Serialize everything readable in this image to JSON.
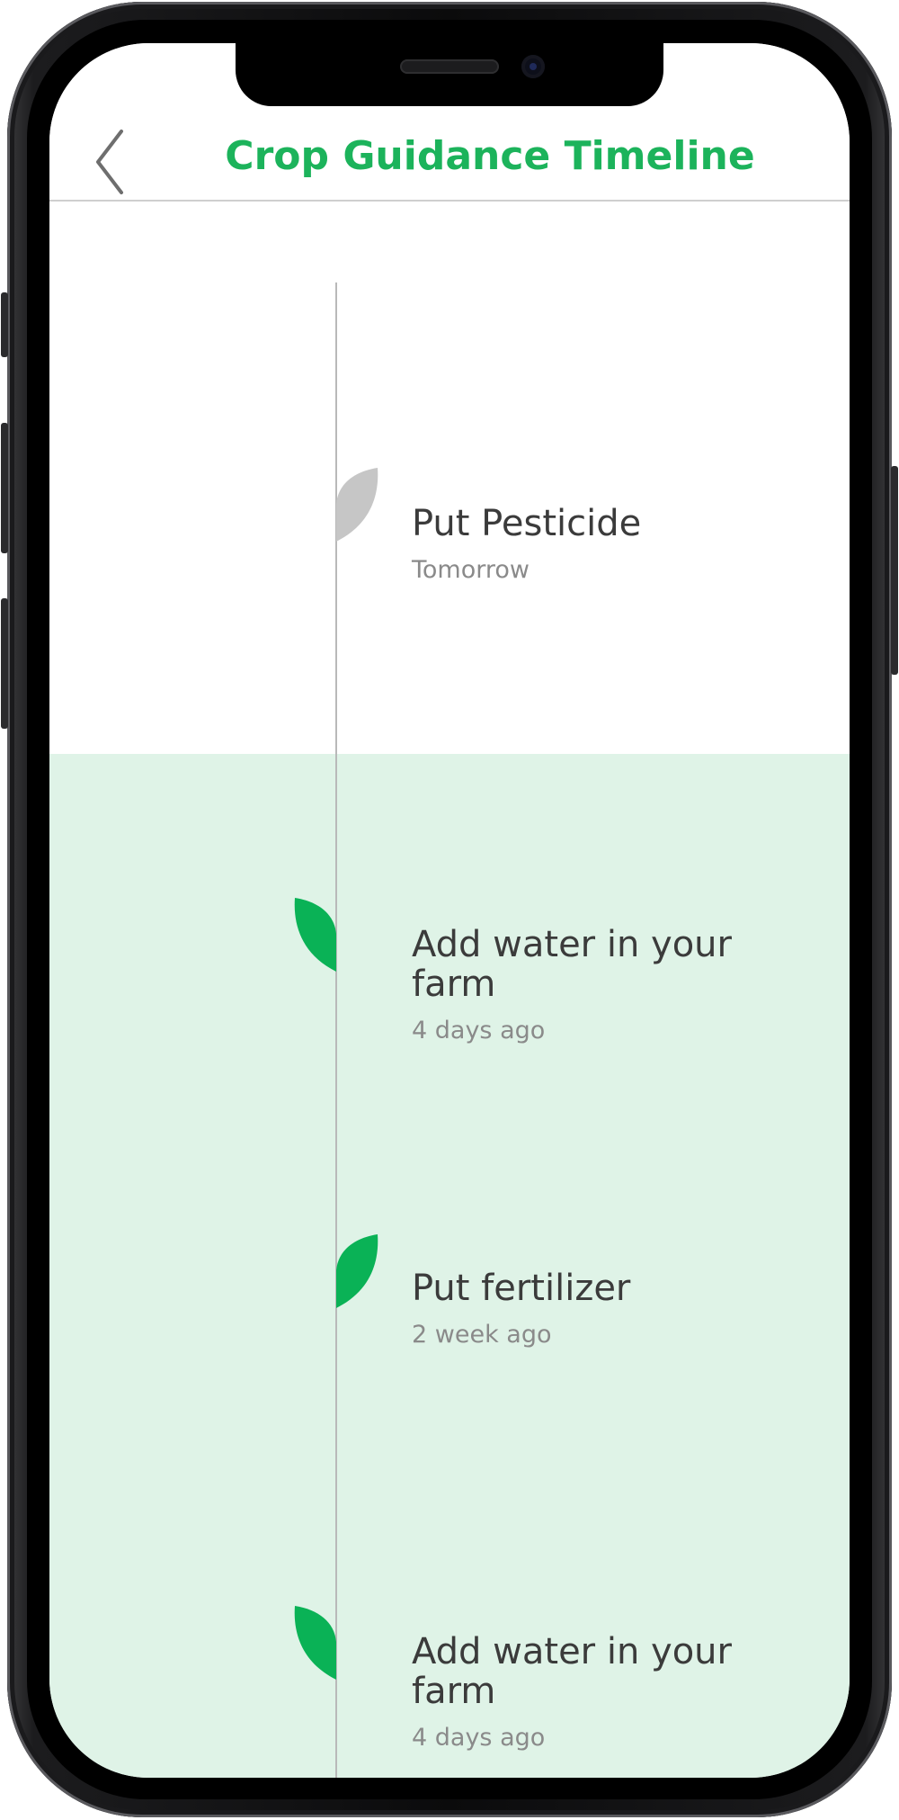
{
  "header": {
    "title": "Crop Guidance Timeline",
    "back_icon": "chevron-left-icon"
  },
  "colors": {
    "accent": "#1cb35b",
    "leaf_upcoming": "#c6c6c6",
    "leaf_done": "#0ab256",
    "completed_bg": "#dff3e7",
    "timeline_line": "#b9b9b9"
  },
  "upcoming": [
    {
      "title": "Put Pesticide",
      "time": "Tomorrow",
      "leaf_icon": "leaf-icon",
      "status": "upcoming"
    }
  ],
  "completed": [
    {
      "title": "Add water in your farm",
      "time": "4 days ago",
      "leaf_icon": "leaf-icon",
      "status": "done"
    },
    {
      "title": "Put fertilizer",
      "time": "2 week ago",
      "leaf_icon": "leaf-icon",
      "status": "done"
    },
    {
      "title": "Add water in your farm",
      "time": "4 days ago",
      "leaf_icon": "leaf-icon",
      "status": "done"
    }
  ]
}
